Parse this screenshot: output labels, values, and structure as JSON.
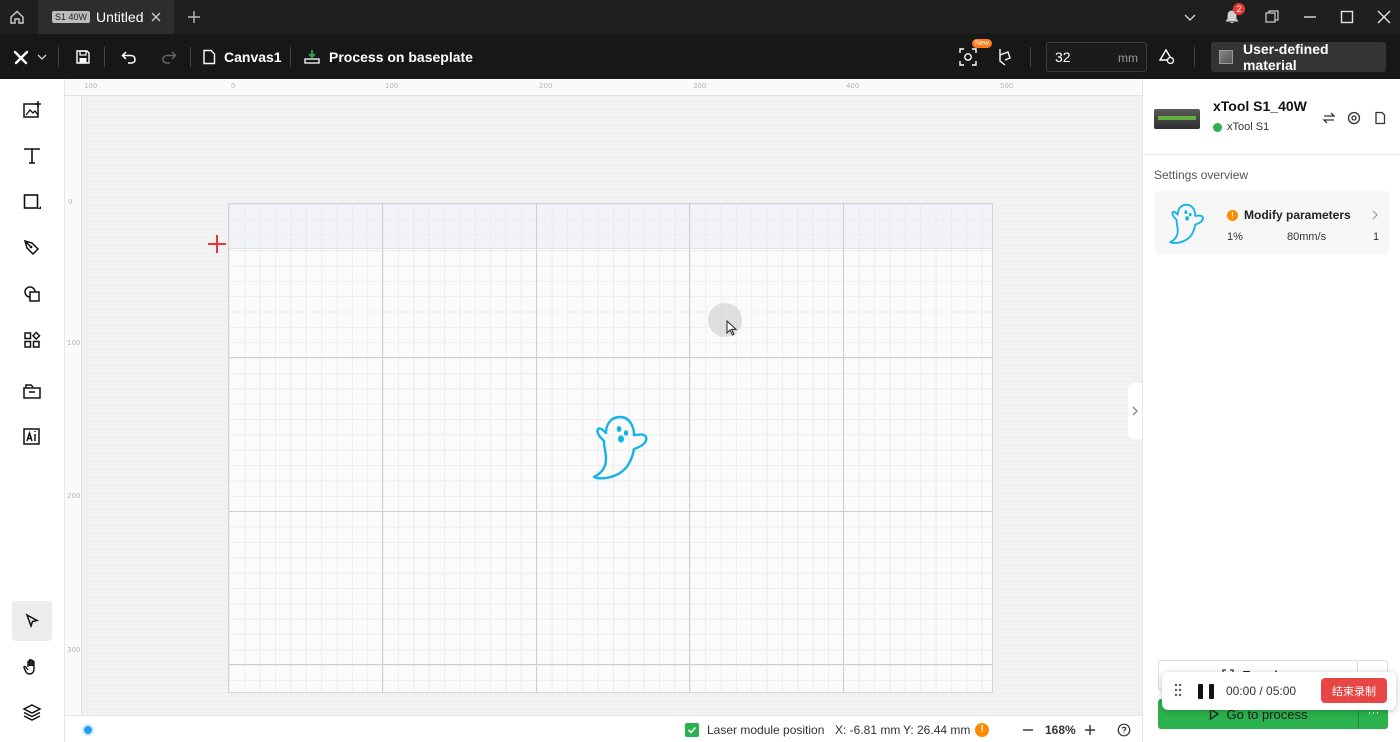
{
  "titlebar": {
    "tab_badge": "S1 40W",
    "tab_title": "Untitled",
    "notifications_count": "2"
  },
  "toolbar": {
    "canvas_label": "Canvas1",
    "process_label": "Process on baseplate",
    "new_tag": "New",
    "thickness_value": "32",
    "thickness_unit": "mm",
    "material_label": "User-defined material"
  },
  "rulers": {
    "top": [
      "100",
      "0",
      "100",
      "200",
      "300",
      "400",
      "500"
    ],
    "left": [
      "0",
      "100",
      "200",
      "300"
    ]
  },
  "statusbar": {
    "laser_position_label": "Laser module position",
    "x_coord": "X: -6.81 mm",
    "y_coord": "Y: 26.44 mm",
    "zoom": "168%"
  },
  "rightpanel": {
    "device_name": "xTool S1_40W",
    "device_model": "xTool S1",
    "settings_title": "Settings overview",
    "param_title": "Modify parameters",
    "power": "1%",
    "speed": "80mm/s",
    "passes": "1",
    "framing_label": "Framing",
    "process_label": "Go to process"
  },
  "recording": {
    "time": "00:00 / 05:00",
    "stop_label": "结束录制"
  },
  "colors": {
    "accent_green": "#2bb24c",
    "design_cyan": "#14b4e6",
    "crosshair_red": "#e53935",
    "warning_orange": "#ff8a00",
    "record_red": "#e84545"
  }
}
